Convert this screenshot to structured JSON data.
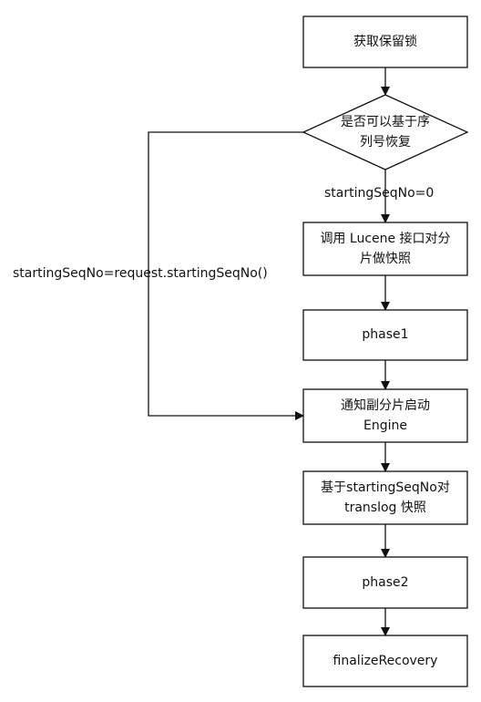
{
  "nodes": {
    "acquire_lock": "获取保留锁",
    "decision_line1": "是否可以基于序",
    "decision_line2": "列号恢复",
    "lucene_snapshot_line1": "调用 Lucene 接口对分",
    "lucene_snapshot_line2": "片做快照",
    "phase1": "phase1",
    "start_engine_line1": "通知副分片启动",
    "start_engine_line2": "Engine",
    "translog_snapshot_line1": "基于startingSeqNo对",
    "translog_snapshot_line2": "translog 快照",
    "phase2": "phase2",
    "finalize": "finalizeRecovery"
  },
  "edges": {
    "no_branch_label": "startingSeqNo=0",
    "yes_branch_label": "startingSeqNo=request.startingSeqNo()"
  }
}
